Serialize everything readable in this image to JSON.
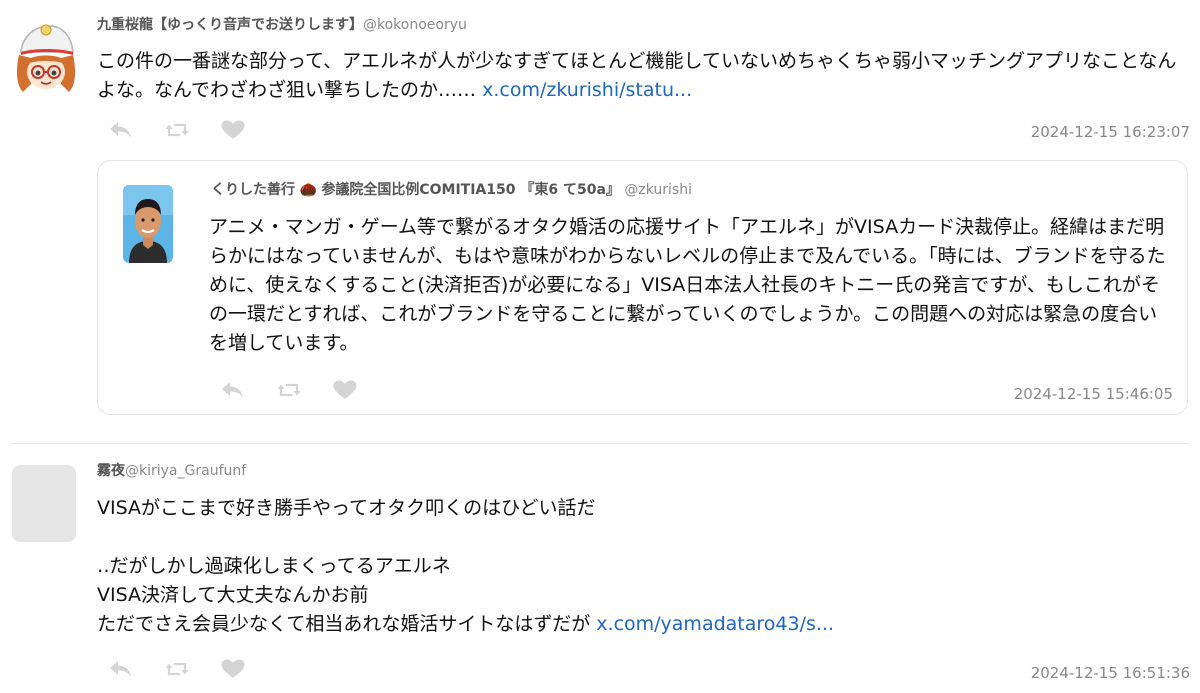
{
  "posts": [
    {
      "display_name": "九重桜龍【ゆっくり音声でお送りします】",
      "handle": "@kokonoeoryu",
      "content_text": "この件の一番謎な部分って、アエルネが人が少なすぎてほとんど機能していないめちゃくちゃ弱小マッチングアプリなことなんよな。なんでわざわざ狙い撃ちしたのか…… ",
      "content_link": "x.com/zkurishi/statu...",
      "timestamp": "2024-12-15 16:23:07",
      "avatar_icon": "yukkuri-avatar-icon",
      "quote": {
        "display_name": "くりした善行",
        "name_emoji": "🌰",
        "name_suffix": "参議院全国比例COMITIA150 『東6 て50a』",
        "handle": "@zkurishi",
        "content_text": "アニメ・マンガ・ゲーム等で繋がるオタク婚活の応援サイト「アエルネ」がVISAカード決裁停止。経緯はまだ明らかにはなっていませんが、もはや意味がわからないレベルの停止まで及んでいる。「時には、ブランドを守るために、使えなくすること(決済拒否)が必要になる」VISA日本法人社長のキトニー氏の発言ですが、もしこれがその一環だとすれば、これがブランドを守ることに繋がっていくのでしょうか。この問題への対応は緊急の度合いを増しています。",
        "timestamp": "2024-12-15 15:46:05",
        "avatar_icon": "person-photo-avatar-icon"
      }
    },
    {
      "display_name": "霧夜",
      "handle": "@kiriya_Graufunf",
      "content_lines": [
        "VISAがここまで好き勝手やってオタク叩くのはひどい話だ",
        "",
        "‥だがしかし過疎化しまくってるアエルネ",
        "VISA決済して大丈夫なんかお前",
        "ただでさえ会員少なくて相当あれな婚活サイトなはずだが "
      ],
      "content_link": "x.com/yamadataro43/s...",
      "timestamp": "2024-12-15 16:51:36",
      "avatar_icon": "placeholder-avatar-icon"
    }
  ],
  "icons": {
    "reply": "reply-icon",
    "retweet": "retweet-icon",
    "like": "heart-icon"
  },
  "colors": {
    "link": "#1c66c6",
    "icon": "#d4d4d4",
    "timestamp": "#888888",
    "border": "#e3e3e3"
  }
}
